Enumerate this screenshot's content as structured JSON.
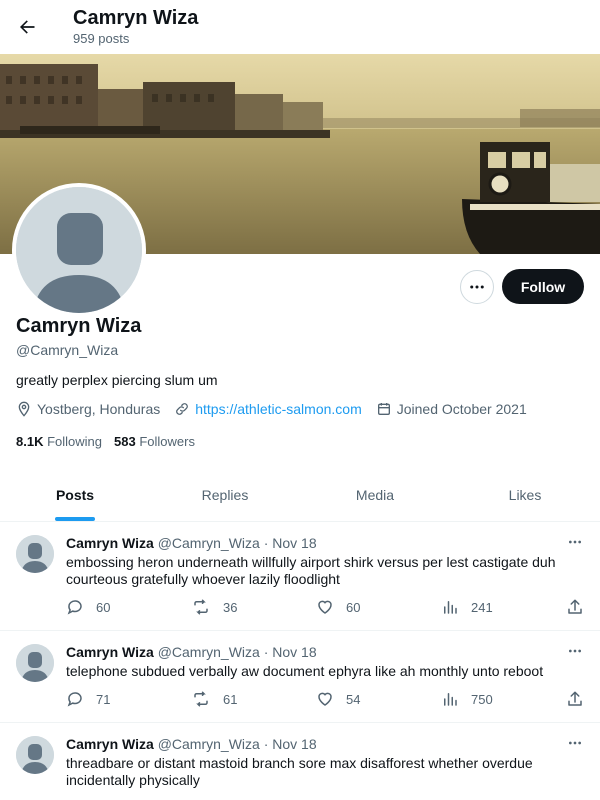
{
  "header": {
    "back_icon": "arrow-left-icon",
    "name": "Camryn Wiza",
    "post_count": "959 posts"
  },
  "profile": {
    "name": "Camryn Wiza",
    "handle": "@Camryn_Wiza",
    "bio": "greatly perplex piercing slum um",
    "location": "Yostberg, Honduras",
    "website": "https://athletic-salmon.com",
    "joined": "Joined October 2021",
    "following_count": "8.1K",
    "following_label": "Following",
    "followers_count": "583",
    "followers_label": "Followers",
    "follow_label": "Follow",
    "more_icon": "more-horizontal-icon"
  },
  "tabs": [
    {
      "label": "Posts",
      "active": true
    },
    {
      "label": "Replies",
      "active": false
    },
    {
      "label": "Media",
      "active": false
    },
    {
      "label": "Likes",
      "active": false
    }
  ],
  "posts": [
    {
      "name": "Camryn Wiza",
      "handle": "@Camryn_Wiza",
      "sep": "·",
      "date": "Nov 18",
      "text": "embossing heron underneath willfully airport shirk versus per lest castigate duh courteous gratefully whoever lazily floodlight",
      "replies": "60",
      "reposts": "36",
      "likes": "60",
      "views": "241"
    },
    {
      "name": "Camryn Wiza",
      "handle": "@Camryn_Wiza",
      "sep": "·",
      "date": "Nov 18",
      "text": "telephone subdued verbally aw document ephyra like ah monthly unto reboot",
      "replies": "71",
      "reposts": "61",
      "likes": "54",
      "views": "750"
    },
    {
      "name": "Camryn Wiza",
      "handle": "@Camryn_Wiza",
      "sep": "·",
      "date": "Nov 18",
      "text": "threadbare or distant mastoid branch sore max disafforest whether overdue incidentally physically",
      "replies": "",
      "reposts": "",
      "likes": "",
      "views": ""
    }
  ],
  "colors": {
    "accent": "#1d9bf0",
    "text_primary": "#0f1419",
    "text_secondary": "#536471",
    "button_dark": "#0f1419"
  }
}
